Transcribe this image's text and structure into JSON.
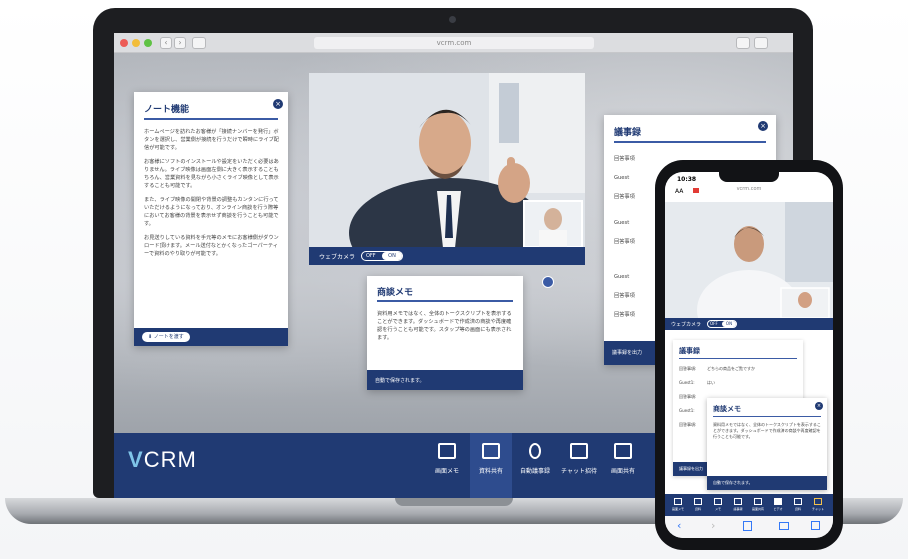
{
  "browser": {
    "url": "vcrm.com",
    "nav_back": "‹",
    "nav_fwd": "›"
  },
  "note_panel": {
    "title": "ノート機能",
    "paragraphs": [
      "ホームページを訪れたお客様が「接続ナンバーを発行」ボタンを選択し、営業側が接続を行うだけで瞬時にライブ配信が可能です。",
      "お客様にソフトのインストールや設定をいただく必要はありません。ライブ映像は画面左側に大きく表示することもちろん、営業資料を見ながら小さくライブ映像として表示することも可能です。",
      "また、ライブ映像の開閉や背景の調整もカンタンに行っていただけるようになっており、オンライン商談を行う際等においてお客様の背景を表示せず商談を行うことも可能です。",
      "お見送りしている資料を手元等のメモにお客様側がダウンロード頂けます。メール送付なとかくなったゴーパーティーで資料のやり取りが可能です。"
    ],
    "button": "ノートを渡す"
  },
  "video": {
    "webcam_label": "ウェブカメラ",
    "toggle_off": "OFF",
    "toggle_on": "ON"
  },
  "memo_panel": {
    "title": "商談メモ",
    "body": "資料用メモではなく、全体のトークスクリプトを表示することができます。ダッシュボードで作成済の商談や再度確認を行うことも可能です。スタップ等の画面にも表示されます。",
    "footer": "自動で保存されます。"
  },
  "minutes_panel": {
    "title": "議事録",
    "rows": [
      "回答事項",
      "Guest",
      "回答事項",
      "Guest",
      "回答事項",
      "Guest",
      "回答事項",
      "回答事項"
    ],
    "footer_label": "議事録を出力"
  },
  "footer": {
    "logo_v": "V",
    "logo_rest": "CRM",
    "tabs": [
      {
        "label": "画面メモ"
      },
      {
        "label": "資料共有"
      },
      {
        "label": "自動議事録"
      },
      {
        "label": "チャット招待"
      },
      {
        "label": "画面共有"
      }
    ]
  },
  "phone": {
    "time": "10:38",
    "url": "vcrm.com",
    "zoom": "AA",
    "webcam_label": "ウェブカメラ",
    "toggle_off": "OFF",
    "toggle_on": "ON",
    "minutes_title": "議事録",
    "minutes_rows": [
      {
        "k": "回答事項:",
        "v": "どちらの商品をご覧ですか"
      },
      {
        "k": "Guest1:",
        "v": "はい"
      },
      {
        "k": "回答事項:",
        "v": ""
      },
      {
        "k": "Guest1:",
        "v": ""
      },
      {
        "k": "回答事項:",
        "v": ""
      }
    ],
    "memo_title": "商談メモ",
    "memo_body": "資料用メモではなく、全体のトークスクリプトを表示することができます。ダッシュボードで作成済の商談や再度確認を行うことも可能です。",
    "memo_footer": "自動で保存されます。",
    "minutes_footer": "議事録を出力",
    "tabs": [
      "画面メモ",
      "資料",
      "メモ",
      "議事録",
      "画面共有",
      "ビデオ",
      "資料",
      "チャット"
    ]
  },
  "colors": {
    "navy": "#203a73",
    "accent": "#3b5ba5",
    "logo_accent": "#7fc4e8"
  }
}
